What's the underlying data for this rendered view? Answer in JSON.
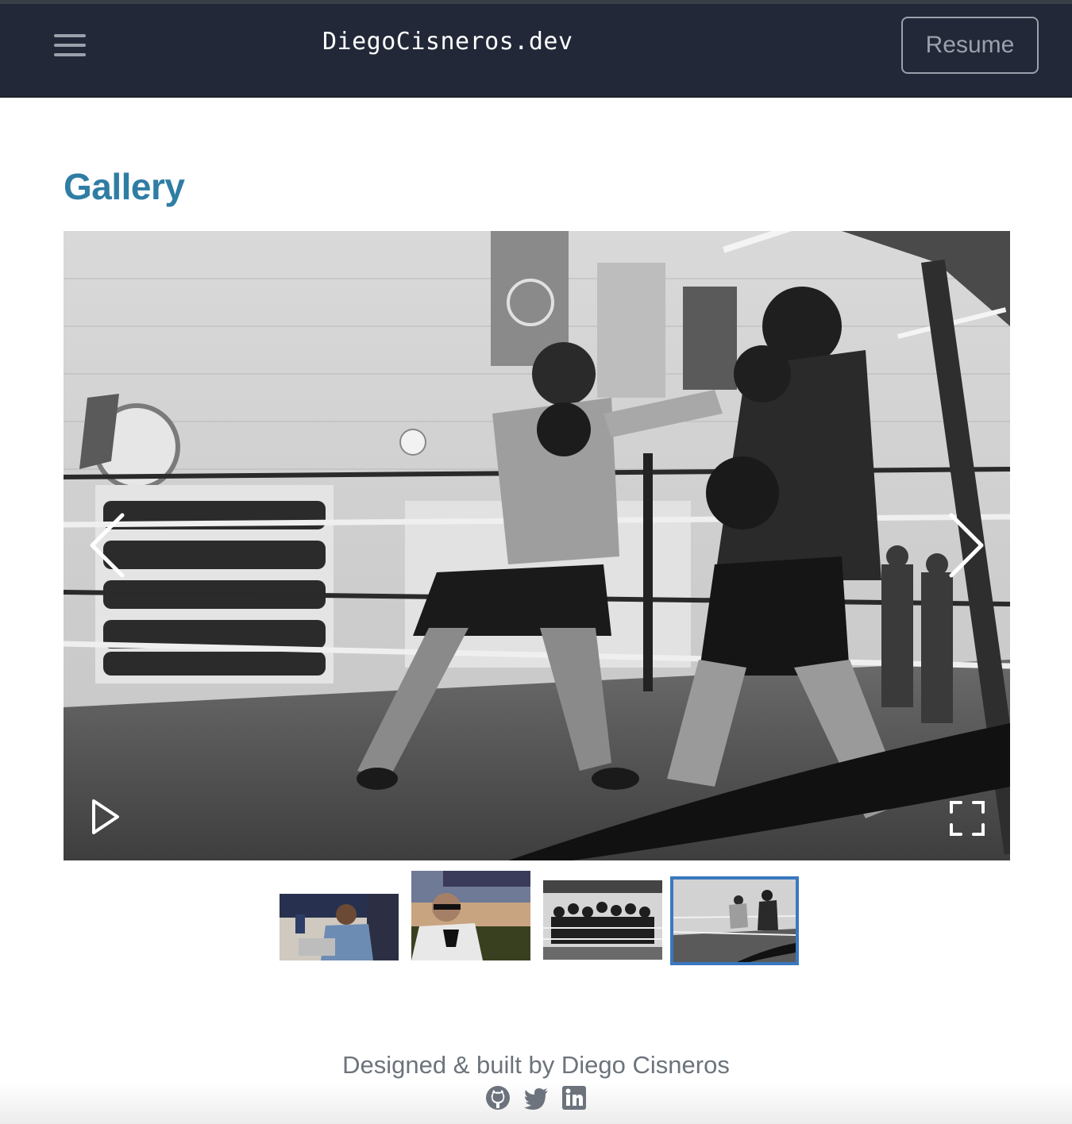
{
  "navbar": {
    "brand": "DiegoCisneros.dev",
    "resume_label": "Resume",
    "menu_icon": "hamburger-menu-icon"
  },
  "main": {
    "title": "Gallery"
  },
  "gallery": {
    "current_slide_index": 4,
    "total_slides": 4,
    "controls": {
      "prev_icon": "chevron-left-icon",
      "next_icon": "chevron-right-icon",
      "play_icon": "play-icon",
      "fullscreen_icon": "fullscreen-icon"
    }
  },
  "footer": {
    "credit": "Designed & built by Diego Cisneros",
    "social_icons": [
      "github-icon",
      "twitter-icon",
      "linkedin-icon"
    ]
  },
  "colors": {
    "navbar_bg": "#222838",
    "title": "#2f7da4",
    "active_thumb_border": "#3a78c0",
    "muted_text": "#6c737c"
  }
}
